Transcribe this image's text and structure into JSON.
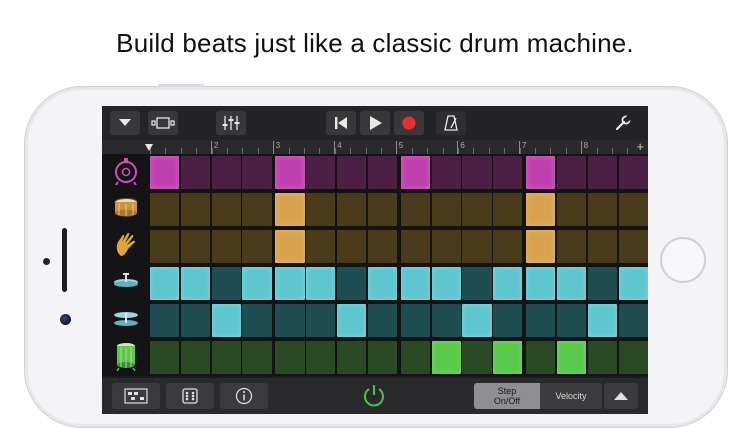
{
  "headline": "Build beats just like a classic drum machine.",
  "ruler": {
    "bars": [
      "2",
      "3",
      "4",
      "5",
      "6",
      "7",
      "8"
    ]
  },
  "colors": {
    "magenta_on": "#c03fae",
    "magenta_off": "#4c1f45",
    "orange_on": "#d9a24e",
    "orange_off": "#4a3b1a",
    "cyan_on": "#5ec6cf",
    "cyan_off": "#1e4e52",
    "green_on": "#58c94a",
    "green_off": "#2a4a26",
    "record": "#e5322c",
    "power": "#4cc24a"
  },
  "tracks": [
    {
      "name": "kick-drum",
      "icon": "kick-drum-icon",
      "color": "magenta",
      "steps": [
        1,
        0,
        0,
        0,
        1,
        0,
        0,
        0,
        1,
        0,
        0,
        0,
        1,
        0,
        0,
        0
      ]
    },
    {
      "name": "snare-drum",
      "icon": "snare-drum-icon",
      "color": "orange",
      "steps": [
        0,
        0,
        0,
        0,
        1,
        0,
        0,
        0,
        0,
        0,
        0,
        0,
        1,
        0,
        0,
        0
      ]
    },
    {
      "name": "hand-clap",
      "icon": "hand-clap-icon",
      "color": "orange",
      "steps": [
        0,
        0,
        0,
        0,
        1,
        0,
        0,
        0,
        0,
        0,
        0,
        0,
        1,
        0,
        0,
        0
      ]
    },
    {
      "name": "closed-hihat",
      "icon": "hihat-closed-icon",
      "color": "cyan",
      "steps": [
        1,
        1,
        0,
        1,
        1,
        1,
        0,
        1,
        1,
        1,
        0,
        1,
        1,
        1,
        0,
        1
      ]
    },
    {
      "name": "open-hihat",
      "icon": "hihat-open-icon",
      "color": "cyan",
      "steps": [
        0,
        0,
        1,
        0,
        0,
        0,
        1,
        0,
        0,
        0,
        1,
        0,
        0,
        0,
        1,
        0
      ]
    },
    {
      "name": "floor-tom",
      "icon": "tom-drum-icon",
      "color": "green",
      "steps": [
        0,
        0,
        0,
        0,
        0,
        0,
        0,
        0,
        0,
        1,
        0,
        1,
        0,
        1,
        0,
        0
      ]
    }
  ],
  "bottom": {
    "step_label_1": "Step",
    "step_label_2": "On/Off",
    "velocity_label": "Velocity"
  }
}
